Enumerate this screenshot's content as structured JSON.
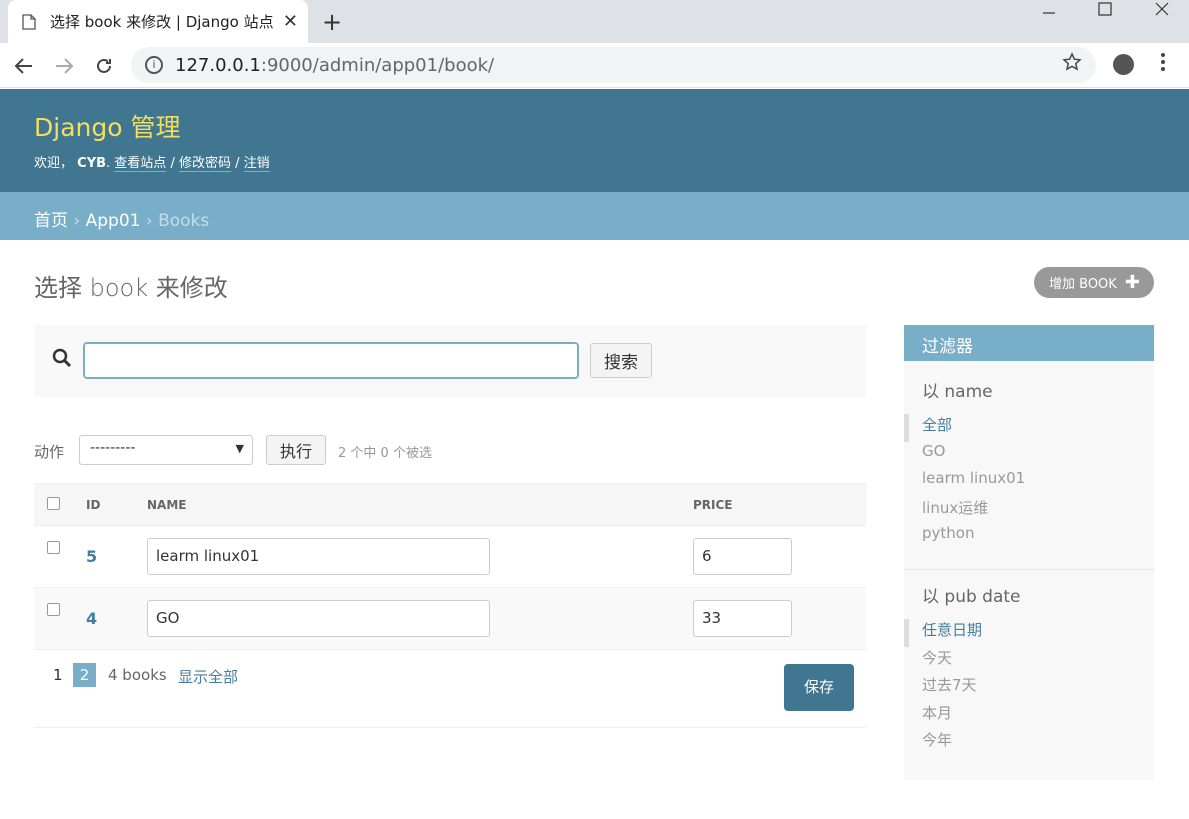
{
  "browser": {
    "tab_title": "选择 book 来修改 | Django 站点",
    "close_glyph": "✕",
    "newtab_glyph": "+",
    "url_host": "127.0.0.1",
    "url_path": ":9000/admin/app01/book/"
  },
  "header": {
    "brand": "Django 管理",
    "welcome": "欢迎，",
    "username": "CYB",
    "view_site": "查看站点",
    "change_password": "修改密码",
    "logout": "注销",
    "sep": "/"
  },
  "breadcrumbs": {
    "home": "首页",
    "app": "App01",
    "current": "Books",
    "sep": "›"
  },
  "page": {
    "title": "选择 book 来修改",
    "add_button": "增加 BOOK"
  },
  "search": {
    "button": "搜索",
    "value": ""
  },
  "actions": {
    "label": "动作",
    "select_value": "---------",
    "go_button": "执行",
    "counter": "2 个中 0 个被选"
  },
  "table": {
    "headers": [
      "ID",
      "NAME",
      "PRICE"
    ],
    "rows": [
      {
        "id": "5",
        "name": "learm linux01",
        "price": "6"
      },
      {
        "id": "4",
        "name": "GO",
        "price": "33"
      }
    ]
  },
  "paginator": {
    "page1": "1",
    "page2": "2",
    "count": "4 books",
    "show_all": "显示全部",
    "save": "保存"
  },
  "filter": {
    "title": "过滤器",
    "groups": [
      {
        "title": "以 name",
        "items": [
          "全部",
          "GO",
          "learm linux01",
          "linux运维",
          "python"
        ]
      },
      {
        "title": "以 pub date",
        "items": [
          "任意日期",
          "今天",
          "过去7天",
          "本月",
          "今年"
        ]
      }
    ]
  }
}
